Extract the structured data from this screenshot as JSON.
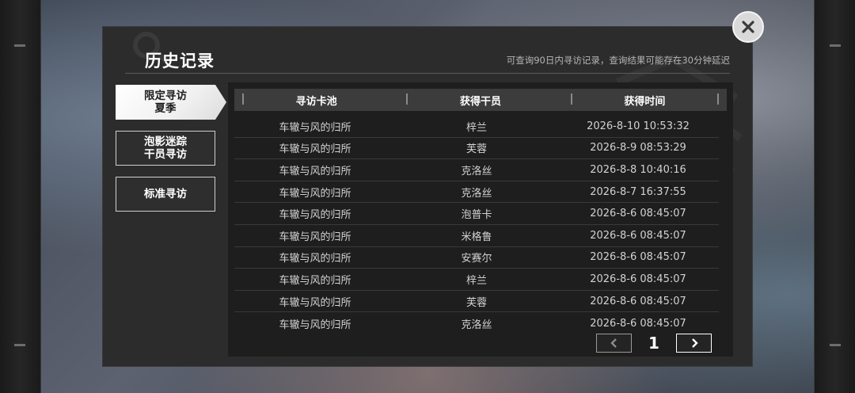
{
  "header": {
    "title": "历史记录",
    "notice": "可查询90日内寻访记录，查询结果可能存在30分钟延迟"
  },
  "tabs": [
    {
      "label": "限定寻访\n夏季",
      "active": true
    },
    {
      "label": "泡影迷踪\n干员寻访",
      "active": false
    },
    {
      "label": "标准寻访",
      "active": false
    }
  ],
  "table": {
    "headers": [
      "寻访卡池",
      "获得干员",
      "获得时间"
    ],
    "rows": [
      [
        "车辙与风的归所",
        "梓兰",
        "2026-8-10 10:53:32"
      ],
      [
        "车辙与风的归所",
        "芙蓉",
        "2026-8-9 08:53:29"
      ],
      [
        "车辙与风的归所",
        "克洛丝",
        "2026-8-8 10:40:16"
      ],
      [
        "车辙与风的归所",
        "克洛丝",
        "2026-8-7 16:37:55"
      ],
      [
        "车辙与风的归所",
        "泡普卡",
        "2026-8-6 08:45:07"
      ],
      [
        "车辙与风的归所",
        "米格鲁",
        "2026-8-6 08:45:07"
      ],
      [
        "车辙与风的归所",
        "安赛尔",
        "2026-8-6 08:45:07"
      ],
      [
        "车辙与风的归所",
        "梓兰",
        "2026-8-6 08:45:07"
      ],
      [
        "车辙与风的归所",
        "芙蓉",
        "2026-8-6 08:45:07"
      ],
      [
        "车辙与风的归所",
        "克洛丝",
        "2026-8-6 08:45:07"
      ]
    ]
  },
  "pagination": {
    "current_page": "1"
  },
  "icons": {
    "close": "close-icon",
    "prev": "chevron-left-icon",
    "next": "chevron-right-icon"
  }
}
